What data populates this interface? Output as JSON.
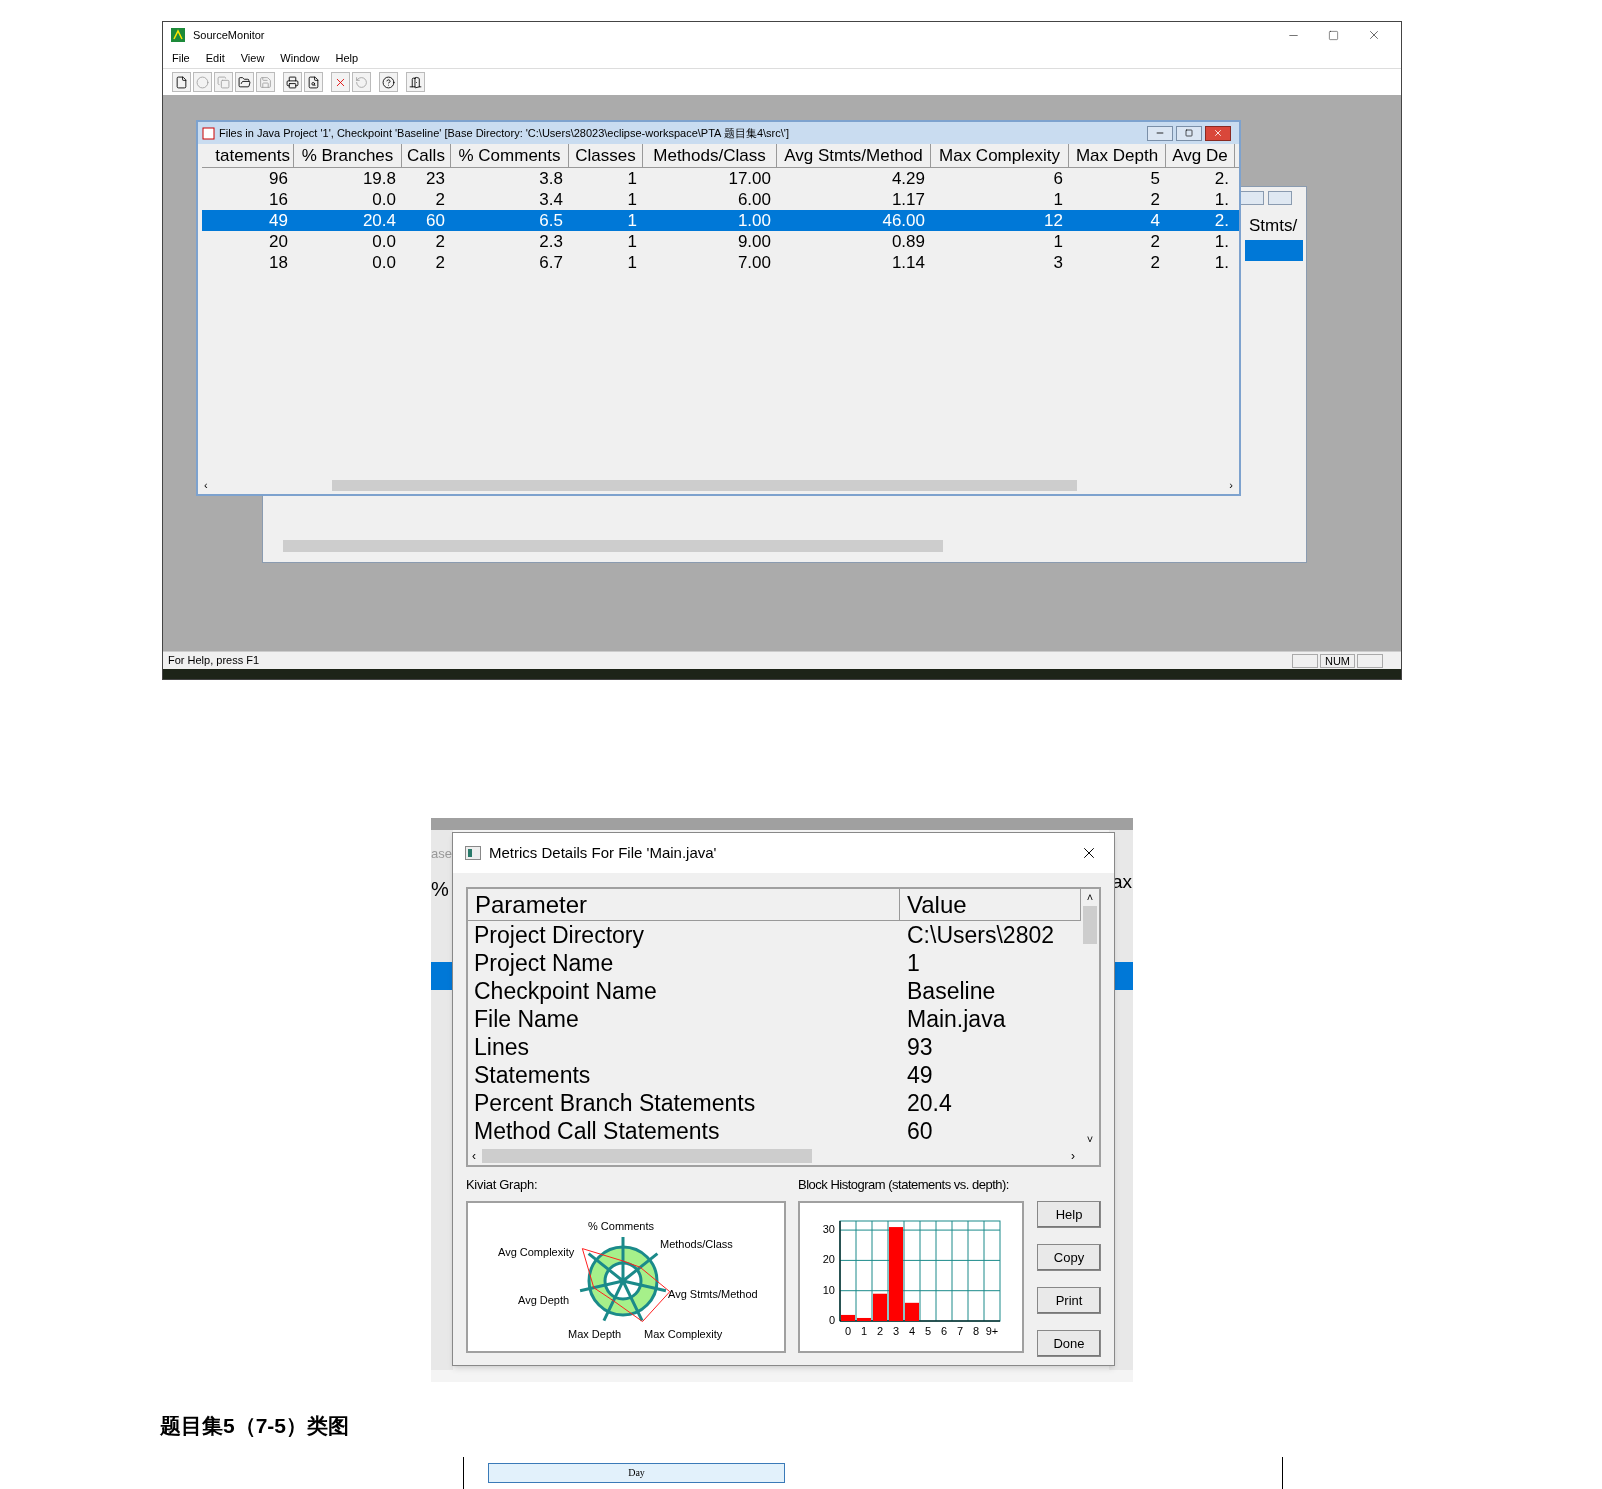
{
  "source_monitor": {
    "title": "SourceMonitor",
    "menu": [
      "File",
      "Edit",
      "View",
      "Window",
      "Help"
    ],
    "toolbar": [
      {
        "disabled": false
      },
      {
        "disabled": true
      },
      {
        "disabled": true
      },
      {
        "disabled": false
      },
      {
        "disabled": true
      },
      {
        "disabled": false
      },
      {
        "disabled": false
      },
      {
        "disabled": false
      },
      {
        "disabled": true
      },
      {
        "disabled": false
      },
      {
        "disabled": false
      }
    ],
    "files_window": {
      "title": "Files in Java Project '1', Checkpoint 'Baseline'  [Base Directory: 'C:\\Users\\28023\\eclipse-workspace\\PTA 题目集4\\src\\']",
      "columns": [
        "tatements",
        "% Branches",
        "Calls",
        "% Comments",
        "Classes",
        "Methods/Class",
        "Avg Stmts/Method",
        "Max Complexity",
        "Max Depth",
        "Avg De"
      ],
      "scroll_arrows": [
        "‹",
        "›"
      ],
      "rows": [
        {
          "selected": false,
          "cells": [
            "96",
            "19.8",
            "23",
            "3.8",
            "1",
            "17.00",
            "4.29",
            "6",
            "5",
            "2."
          ]
        },
        {
          "selected": false,
          "cells": [
            "16",
            "0.0",
            "2",
            "3.4",
            "1",
            "6.00",
            "1.17",
            "1",
            "2",
            "1."
          ]
        },
        {
          "selected": true,
          "cells": [
            "49",
            "20.4",
            "60",
            "6.5",
            "1",
            "1.00",
            "46.00",
            "12",
            "4",
            "2."
          ]
        },
        {
          "selected": false,
          "cells": [
            "20",
            "0.0",
            "2",
            "2.3",
            "1",
            "9.00",
            "0.89",
            "1",
            "2",
            "1."
          ]
        },
        {
          "selected": false,
          "cells": [
            "18",
            "0.0",
            "2",
            "6.7",
            "1",
            "7.00",
            "1.14",
            "3",
            "2",
            "1."
          ]
        }
      ]
    },
    "back_window": {
      "column": "Stmts/",
      "rows": [
        {
          "selected": true
        }
      ]
    },
    "status_bar": {
      "text": "For Help, press F1",
      "panes": [
        "NUM"
      ]
    }
  },
  "metrics_dialog": {
    "behind_left": [
      "ase",
      "%"
    ],
    "behind_right": [
      "ax"
    ],
    "title": "Metrics Details For File 'Main.java'",
    "columns": [
      "Parameter",
      "Value"
    ],
    "scroll_arrows": [
      "˄",
      "˅",
      "‹",
      "›"
    ],
    "rows": [
      [
        "Project Directory",
        "C:\\Users\\2802"
      ],
      [
        "Project Name",
        "1"
      ],
      [
        "Checkpoint Name",
        "Baseline"
      ],
      [
        "File Name",
        "Main.java"
      ],
      [
        "Lines",
        "93"
      ],
      [
        "Statements",
        "49"
      ],
      [
        "Percent Branch Statements",
        "20.4"
      ],
      [
        "Method Call Statements",
        "60"
      ]
    ],
    "kiviat": {
      "label": "Kiviat Graph:",
      "axes": [
        "% Comments",
        "Avg Complexity",
        "Methods/Class",
        "Avg Depth",
        "Avg Stmts/Method",
        "Max Depth",
        "Max Complexity"
      ]
    },
    "histogram": {
      "label": "Block Histogram (statements vs. depth):",
      "chart_data": {
        "type": "bar",
        "categories": [
          "0",
          "1",
          "2",
          "3",
          "4",
          "5",
          "6",
          "7",
          "8",
          "9+"
        ],
        "values": [
          2,
          1,
          9,
          31,
          6,
          0,
          0,
          0,
          0,
          0
        ],
        "yticks": [
          0,
          10,
          20,
          30
        ],
        "ylim": [
          0,
          33
        ],
        "grid": true
      }
    },
    "buttons": [
      "Help",
      "Copy",
      "Print",
      "Done"
    ]
  },
  "heading": "题目集5（7-5）类图",
  "diagram": {
    "class_name": "Day"
  }
}
